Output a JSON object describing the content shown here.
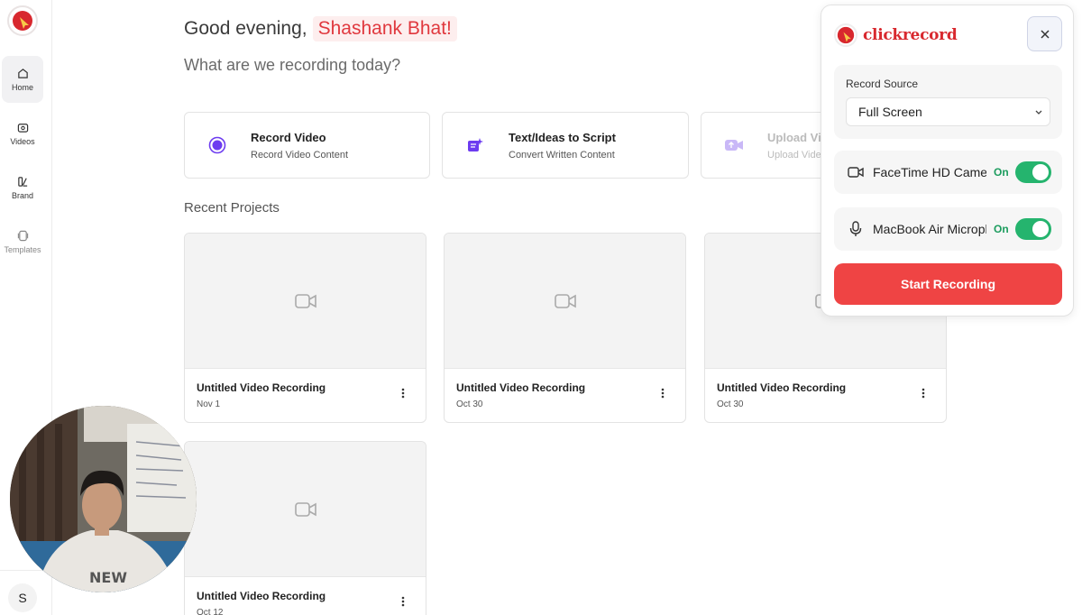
{
  "sidebar": {
    "items": [
      {
        "label": "Home",
        "icon": "home-icon"
      },
      {
        "label": "Videos",
        "icon": "video-icon"
      },
      {
        "label": "Brand",
        "icon": "brand-icon"
      },
      {
        "label": "Templates",
        "icon": "templates-icon"
      }
    ],
    "user_initial": "S"
  },
  "main": {
    "greeting_prefix": "Good evening,",
    "user_name": "Shashank Bhat!",
    "subtitle": "What are we recording today?",
    "actions": [
      {
        "title": "Record Video",
        "subtitle": "Record Video Content",
        "icon": "record-icon"
      },
      {
        "title": "Text/Ideas to Script",
        "subtitle": "Convert Written Content",
        "icon": "script-icon"
      },
      {
        "title": "Upload Vid",
        "subtitle": "Upload Video",
        "icon": "upload-video-icon"
      }
    ],
    "recent_title": "Recent Projects",
    "projects": [
      {
        "title": "Untitled Video Recording",
        "date": "Nov 1"
      },
      {
        "title": "Untitled Video Recording",
        "date": "Oct 30"
      },
      {
        "title": "Untitled Video Recording",
        "date": "Oct 30"
      },
      {
        "title": "Untitled Video Recording",
        "date": "Oct 12"
      }
    ]
  },
  "popup": {
    "brand": "clickrecord",
    "record_source_label": "Record Source",
    "record_source_value": "Full Screen",
    "devices": [
      {
        "name": "FaceTime HD Camera",
        "status": "On",
        "icon": "camera-icon"
      },
      {
        "name": "MacBook Air Microphone",
        "status": "On",
        "icon": "microphone-icon"
      }
    ],
    "start_label": "Start Recording"
  },
  "colors": {
    "accent": "#ef4444",
    "name_highlight": "#e0383e",
    "toggle_on": "#25b46e",
    "brand": "#d8282e",
    "record_purple": "#6d3cf0"
  }
}
